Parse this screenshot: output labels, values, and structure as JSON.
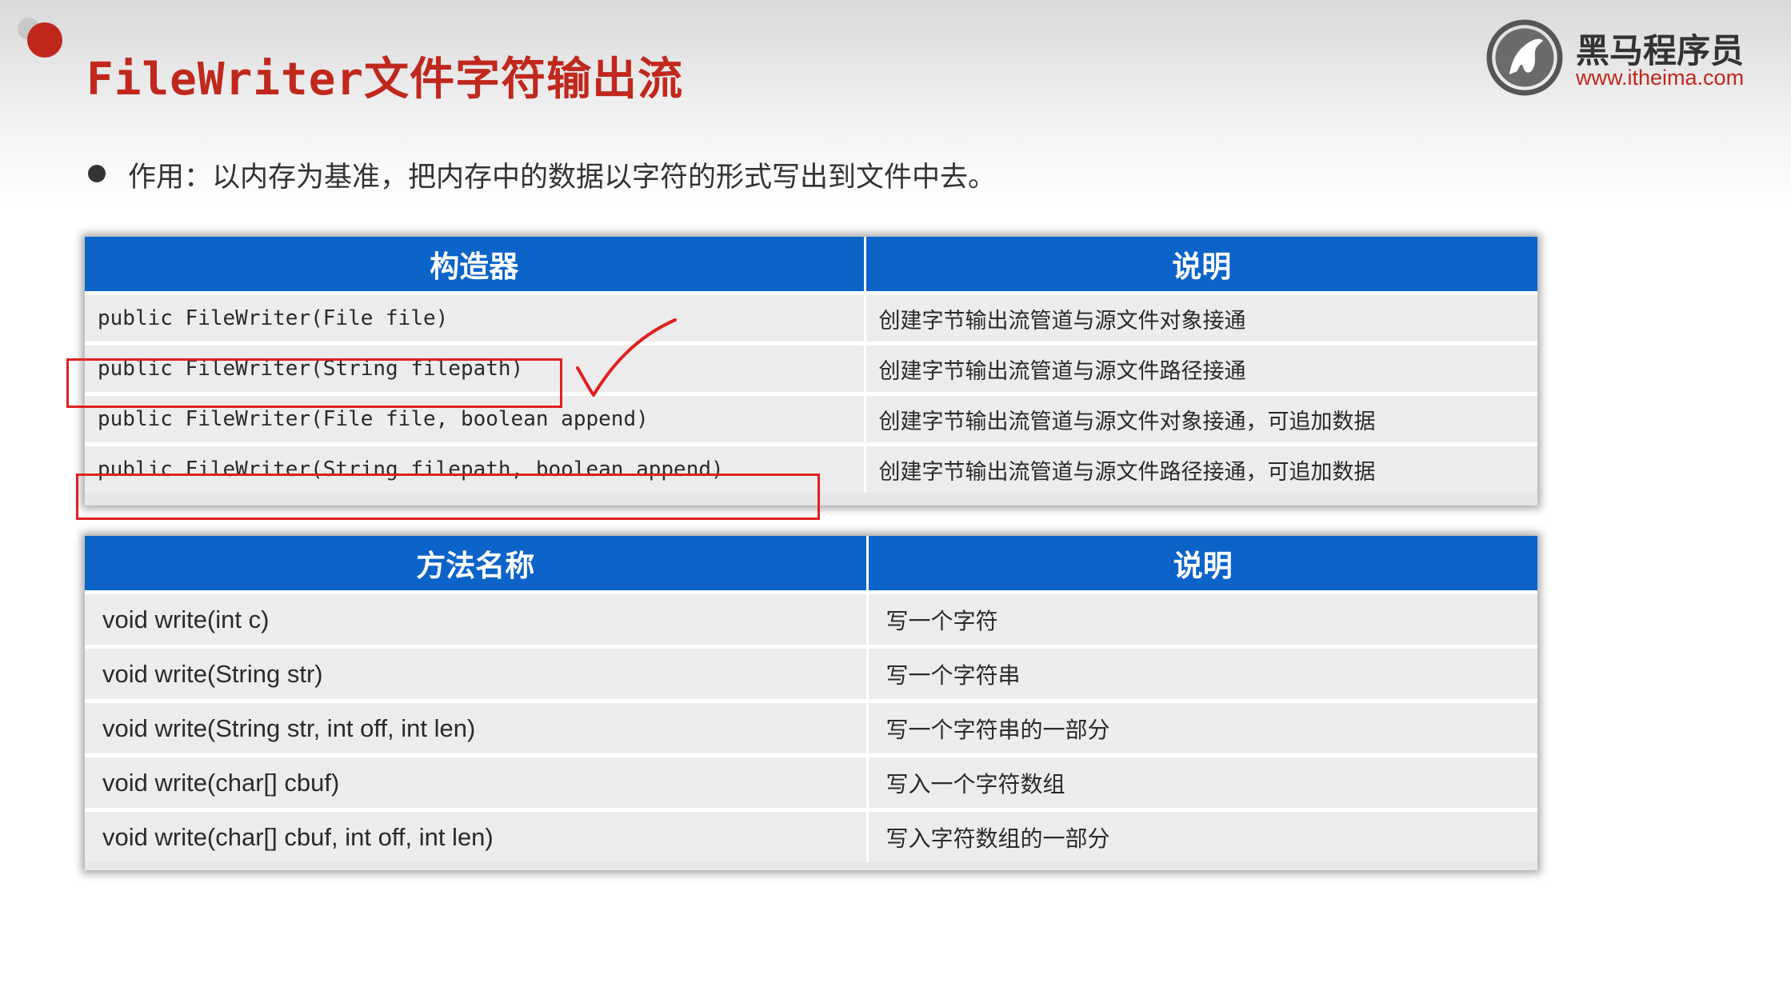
{
  "header": {
    "title": "FileWriter文件字符输出流",
    "logo_name": "黑马程序员",
    "logo_url": "www.itheima.com"
  },
  "bullet": "作用：以内存为基准，把内存中的数据以字符的形式写出到文件中去。",
  "constructor_table": {
    "headers": [
      "构造器",
      "说明"
    ],
    "rows": [
      {
        "code": "public FileWriter(File file)",
        "desc": "创建字节输出流管道与源文件对象接通"
      },
      {
        "code": "public FileWriter(String filepath)",
        "desc": "创建字节输出流管道与源文件路径接通"
      },
      {
        "code": "public FileWriter(File file, boolean append)",
        "desc": "创建字节输出流管道与源文件对象接通，可追加数据"
      },
      {
        "code": "public FileWriter(String filepath, boolean append)",
        "desc": "创建字节输出流管道与源文件路径接通，可追加数据"
      }
    ]
  },
  "method_table": {
    "headers": [
      "方法名称",
      "说明"
    ],
    "rows": [
      {
        "method": "void write(int c)",
        "desc": "写一个字符"
      },
      {
        "method": "void write(String str)",
        "desc": "写一个字符串"
      },
      {
        "method": "void write(String str, int off, int len)",
        "desc": "写一个字符串的一部分"
      },
      {
        "method": "void write(char[] cbuf)",
        "desc": "写入一个字符数组"
      },
      {
        "method": "void write(char[] cbuf, int off, int len)",
        "desc": "写入字符数组的一部分"
      }
    ]
  },
  "colors": {
    "accent_red": "#c0281d",
    "header_blue": "#0c64c8",
    "highlight_red": "#e02020"
  },
  "icons": [
    "record-dot-icon",
    "itheima-horse-logo-icon",
    "bullet-icon",
    "checkmark-icon"
  ]
}
